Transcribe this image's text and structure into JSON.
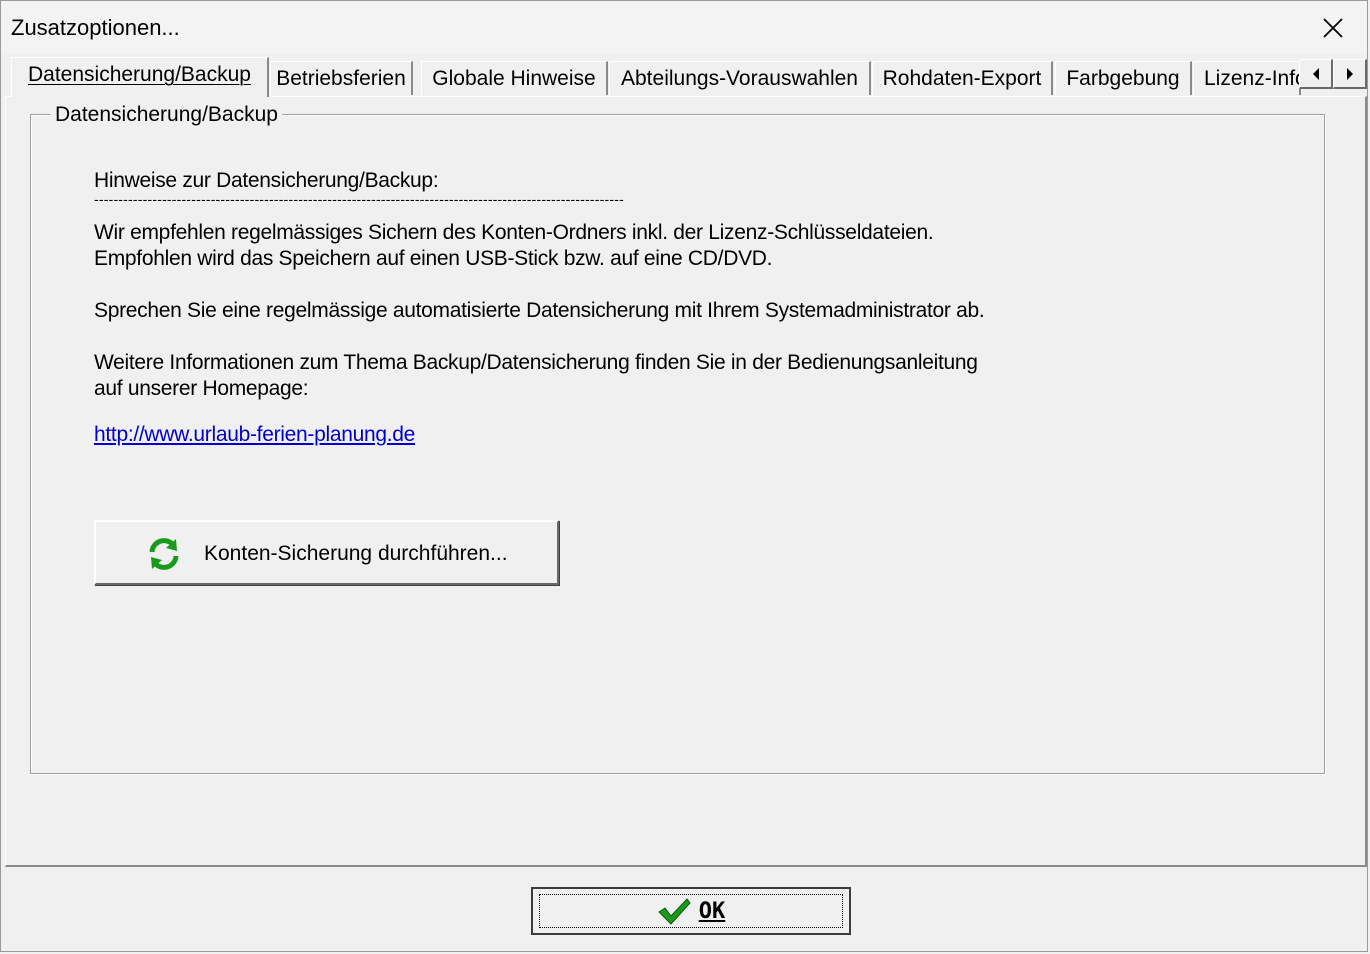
{
  "window": {
    "title": "Zusatzoptionen..."
  },
  "tabs": [
    {
      "label": "Datensicherung/Backup",
      "active": true
    },
    {
      "label": "Betriebsferien"
    },
    {
      "label": "Globale Hinweise"
    },
    {
      "label": "Abteilungs-Vorauswahlen"
    },
    {
      "label": "Rohdaten-Export"
    },
    {
      "label": "Farbgebung"
    },
    {
      "label": "Lizenz-Info"
    }
  ],
  "group": {
    "title": "Datensicherung/Backup",
    "heading": "Hinweise zur Datensicherung/Backup:",
    "separator": "-------------------------------------------------------------------------------------------------------------",
    "line1": "Wir empfehlen regelmässiges Sichern des Konten-Ordners inkl. der Lizenz-Schlüsseldateien.",
    "line2": "Empfohlen wird das Speichern auf einen USB-Stick bzw. auf eine CD/DVD.",
    "line3": "Sprechen Sie eine regelmässige automatisierte Datensicherung mit Ihrem Systemadministrator ab.",
    "line4": "Weitere Informationen zum Thema Backup/Datensicherung finden Sie in der Bedienungsanleitung",
    "line5": "auf unserer Homepage:",
    "link": "http://www.urlaub-ferien-planung.de",
    "backup_button": "Konten-Sicherung durchführen..."
  },
  "ok_button": "OK",
  "colors": {
    "link": "#0000cc",
    "icon_green": "#1a9a1a"
  }
}
